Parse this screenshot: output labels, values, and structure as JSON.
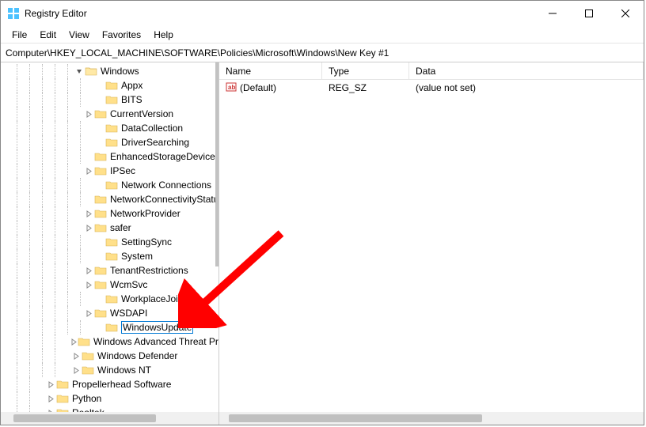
{
  "window": {
    "title": "Registry Editor"
  },
  "menus": [
    "File",
    "Edit",
    "View",
    "Favorites",
    "Help"
  ],
  "address": "Computer\\HKEY_LOCAL_MACHINE\\SOFTWARE\\Policies\\Microsoft\\Windows\\New Key #1",
  "tree": {
    "root_expanded": {
      "label": "Windows",
      "indent": 92,
      "expander": "open",
      "children": [
        {
          "label": "Appx",
          "indent": 118,
          "expander": "none"
        },
        {
          "label": "BITS",
          "indent": 118,
          "expander": "none"
        },
        {
          "label": "CurrentVersion",
          "indent": 104,
          "expander": "closed"
        },
        {
          "label": "DataCollection",
          "indent": 118,
          "expander": "none"
        },
        {
          "label": "DriverSearching",
          "indent": 118,
          "expander": "none"
        },
        {
          "label": "EnhancedStorageDevices",
          "indent": 118,
          "expander": "none"
        },
        {
          "label": "IPSec",
          "indent": 104,
          "expander": "closed"
        },
        {
          "label": "Network Connections",
          "indent": 118,
          "expander": "none"
        },
        {
          "label": "NetworkConnectivityStatusIndicator",
          "indent": 118,
          "expander": "none"
        },
        {
          "label": "NetworkProvider",
          "indent": 104,
          "expander": "closed"
        },
        {
          "label": "safer",
          "indent": 104,
          "expander": "closed"
        },
        {
          "label": "SettingSync",
          "indent": 118,
          "expander": "none"
        },
        {
          "label": "System",
          "indent": 118,
          "expander": "none"
        },
        {
          "label": "TenantRestrictions",
          "indent": 104,
          "expander": "closed"
        },
        {
          "label": "WcmSvc",
          "indent": 104,
          "expander": "closed"
        },
        {
          "label": "WorkplaceJoin",
          "indent": 118,
          "expander": "none"
        },
        {
          "label": "WSDAPI",
          "indent": 104,
          "expander": "closed"
        },
        {
          "label": "WindowsUpdate",
          "indent": 118,
          "expander": "none",
          "editing": true
        }
      ],
      "siblings_after": [
        {
          "label": "Windows Advanced Threat Protection",
          "indent": 88,
          "expander": "closed"
        },
        {
          "label": "Windows Defender",
          "indent": 88,
          "expander": "closed"
        },
        {
          "label": "Windows NT",
          "indent": 88,
          "expander": "closed"
        }
      ],
      "parent_siblings": [
        {
          "label": "Propellerhead Software",
          "indent": 56,
          "expander": "closed"
        },
        {
          "label": "Python",
          "indent": 56,
          "expander": "closed"
        },
        {
          "label": "Realtek",
          "indent": 56,
          "expander": "closed"
        }
      ]
    }
  },
  "list": {
    "columns": [
      "Name",
      "Type",
      "Data"
    ],
    "rows": [
      {
        "name": "(Default)",
        "type": "REG_SZ",
        "data": "(value not set)",
        "icon": "string"
      }
    ]
  }
}
